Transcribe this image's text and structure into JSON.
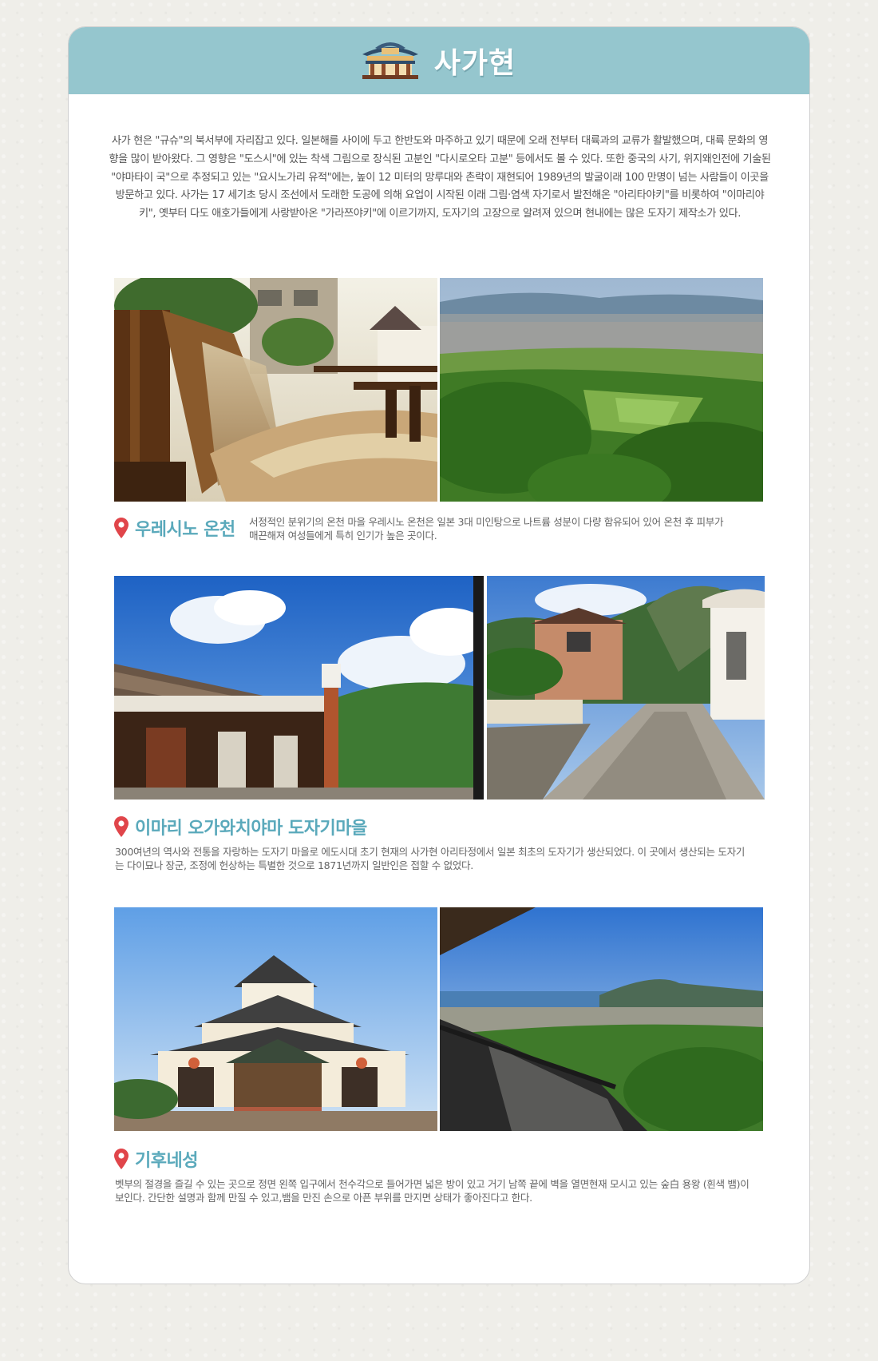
{
  "header": {
    "title": "사가현",
    "icon": "japanese-pavilion-icon"
  },
  "intro": "사가 현은 \"규슈\"의 북서부에 자리잡고 있다. 일본해를 사이에 두고 한반도와 마주하고 있기 때문에 오래 전부터 대륙과의 교류가 활발했으며, 대륙 문화의 영향을 많이 받아왔다. 그 영향은 \"도스시\"에 있는 착색 그림으로 장식된 고분인 \"다시로오타 고분\" 등에서도 볼 수 있다. 또한 중국의 사기, 위지왜인전에 기술된 \"야마타이 국\"으로 추정되고 있는 \"요시노가리 유적\"에는, 높이 12 미터의 망루대와 촌락이 재현되어 1989년의 발굴이래 100 만명이 넘는 사람들이 이곳을 방문하고 있다. 사가는 17 세기초 당시 조선에서 도래한 도공에 의해 요업이 시작된 이래 그림·염색 자기로서 발전해온 \"아리타야키\"를 비롯하여 \"이마리야키\", 옛부터 다도 애호가들에게 사랑받아온 \"가라쯔야키\"에 이르기까지, 도자기의 고장으로 알려져 있으며 현내에는 많은 도자기 제작소가 있다.",
  "places": [
    {
      "name": "우레시노 온천",
      "description": "서정적인 분위기의 온천 마을 우레시노 온천은 일본 3대 미인탕으로 나트륨 성분이 다량 함유되어 있어 온천 후 피부가 매끈해져 여성들에게 특히 인기가 높은 곳이다.",
      "photos": [
        "waterwheel-hot-spring-photo",
        "green-valley-town-photo"
      ]
    },
    {
      "name": "이마리 오가와치야마 도자기마을",
      "description": "300여년의 역사와 전통을 자랑하는 도자기 마을로 에도시대 초기 현재의 사가현 아리타정에서 일본 최초의 도자기가 생산되었다. 이 곳에서 생산되는 도자기는 다이묘나 장군, 조정에 헌상하는 특별한 것으로 1871년까지 일반인은 접할 수 없었다.",
      "photos": [
        "pottery-house-chimney-photo",
        "stone-street-village-photo"
      ]
    },
    {
      "name": "기후네성",
      "description": "벳부의 절경을 즐길 수 있는 곳으로 정면 왼쪽 입구에서 천수각으로 들어가면 넓은 방이 있고 거기 남쪽 끝에 벽을 열면현재 모시고 있는 숲白 용왕 (흰색 뱀)이 보인다. 간단한 설명과 함께 만질 수 있고,뱀을 만진 손으로 아픈 부위를 만지면 상태가 좋아진다고 한다.",
      "photos": [
        "castle-front-photo",
        "castle-sea-view-photo"
      ]
    }
  ],
  "colors": {
    "header": "#95c6ce",
    "accent": "#5aa9bb",
    "pin": "#e0454a"
  }
}
